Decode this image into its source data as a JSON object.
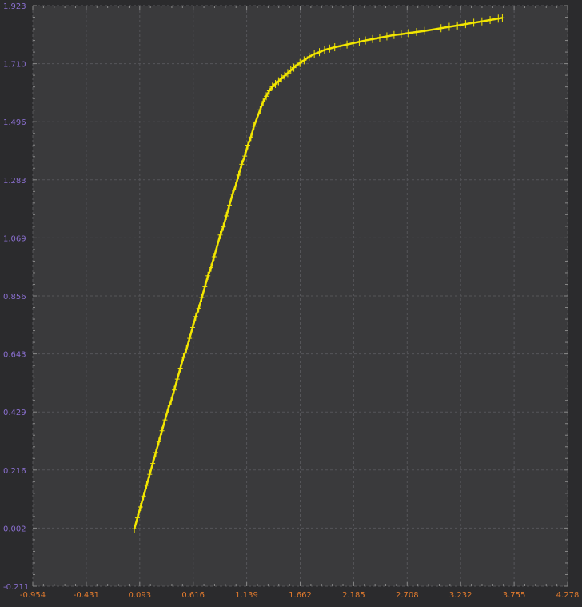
{
  "colors": {
    "background": "#2b2b2d",
    "plot_area": "#3a3a3c",
    "grid": "#555559",
    "series": "#f2e600",
    "y_tick_label": "#8a6fd0",
    "x_tick_label": "#e07a2e"
  },
  "chart_data": {
    "type": "scatter",
    "title": "",
    "xlabel": "",
    "ylabel": "",
    "grid": true,
    "marker": "cross",
    "xlim": [
      -0.954,
      4.278
    ],
    "ylim": [
      -0.211,
      1.923
    ],
    "x_ticks": [
      "-0.954",
      "-0.431",
      "0.093",
      "0.616",
      "1.139",
      "1.662",
      "2.185",
      "2.708",
      "3.232",
      "3.755",
      "4.278"
    ],
    "y_ticks": [
      "-0.211",
      "0.002",
      "0.216",
      "0.429",
      "0.643",
      "0.856",
      "1.069",
      "1.283",
      "1.496",
      "1.710",
      "1.923"
    ],
    "series": [
      {
        "x": [
          0.04,
          0.07,
          0.1,
          0.13,
          0.16,
          0.19,
          0.22,
          0.25,
          0.28,
          0.31,
          0.34,
          0.37,
          0.4,
          0.43,
          0.46,
          0.49,
          0.52,
          0.55,
          0.58,
          0.61,
          0.64,
          0.67,
          0.7,
          0.73,
          0.76,
          0.79,
          0.82,
          0.85,
          0.88,
          0.91,
          0.94,
          0.97,
          1.0,
          1.03,
          1.06,
          1.09,
          1.12,
          1.15,
          1.18,
          1.21,
          1.24,
          1.27,
          1.3,
          1.33,
          1.36,
          1.39,
          1.42,
          1.45,
          1.48,
          1.51,
          1.54,
          1.57,
          1.6,
          1.63,
          1.66,
          1.7,
          1.75,
          1.8,
          1.85,
          1.9,
          1.95,
          2.0,
          2.06,
          2.12,
          2.18,
          2.24,
          2.3,
          2.37,
          2.44,
          2.51,
          2.58,
          2.65,
          2.72,
          2.8,
          2.88,
          2.96,
          3.04,
          3.12,
          3.2,
          3.28,
          3.36,
          3.44,
          3.52,
          3.6,
          3.64
        ],
        "y": [
          0.0,
          0.04,
          0.08,
          0.12,
          0.16,
          0.2,
          0.24,
          0.28,
          0.32,
          0.36,
          0.4,
          0.44,
          0.47,
          0.51,
          0.55,
          0.59,
          0.63,
          0.66,
          0.7,
          0.74,
          0.78,
          0.81,
          0.85,
          0.89,
          0.93,
          0.96,
          1.0,
          1.04,
          1.08,
          1.11,
          1.15,
          1.19,
          1.23,
          1.26,
          1.3,
          1.34,
          1.37,
          1.41,
          1.44,
          1.48,
          1.51,
          1.54,
          1.57,
          1.59,
          1.61,
          1.625,
          1.635,
          1.645,
          1.655,
          1.665,
          1.675,
          1.685,
          1.695,
          1.705,
          1.712,
          1.722,
          1.735,
          1.745,
          1.752,
          1.76,
          1.765,
          1.77,
          1.775,
          1.78,
          1.785,
          1.79,
          1.795,
          1.8,
          1.805,
          1.81,
          1.815,
          1.818,
          1.822,
          1.826,
          1.83,
          1.835,
          1.84,
          1.845,
          1.85,
          1.855,
          1.86,
          1.865,
          1.87,
          1.875,
          1.878
        ]
      }
    ]
  }
}
